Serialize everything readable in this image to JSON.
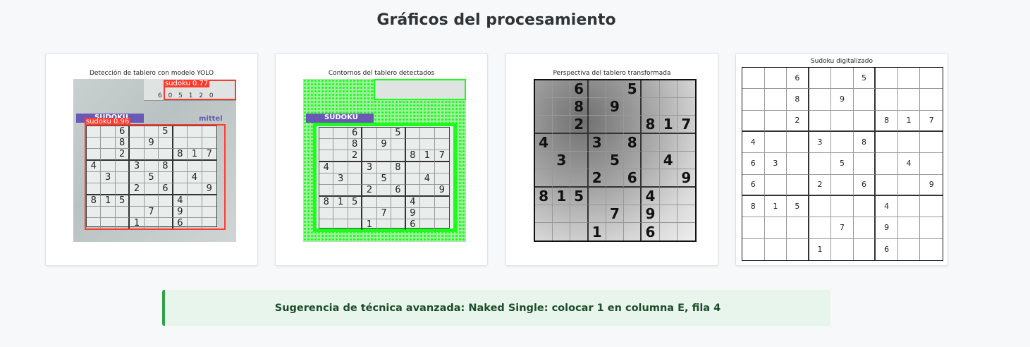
{
  "header": {
    "title": "Gráficos del procesamiento"
  },
  "panels": [
    {
      "title": "Detección de tablero con modelo YOLO"
    },
    {
      "title": "Contornos del tablero detectados"
    },
    {
      "title": "Perspectiva del tablero transformada"
    },
    {
      "title": "Sudoku digitalizado"
    }
  ],
  "detections": [
    {
      "label": "sudoku 0.77",
      "confidence": 0.77
    },
    {
      "label": "sudoku 0.96",
      "confidence": 0.96
    }
  ],
  "photo_text": {
    "brand_left": "SUDOKU",
    "brand_right": "mittel",
    "top_strip_digits": "6 0 5 1 2 0"
  },
  "board": [
    [
      "",
      "",
      "6",
      "",
      "",
      "5",
      "",
      "",
      ""
    ],
    [
      "",
      "",
      "8",
      "",
      "9",
      "",
      "",
      "",
      ""
    ],
    [
      "",
      "",
      "2",
      "",
      "",
      "",
      "8",
      "1",
      "7"
    ],
    [
      "4",
      "",
      "",
      "3",
      "",
      "8",
      "",
      "",
      ""
    ],
    [
      "6",
      "3",
      "",
      "",
      "5",
      "",
      "",
      "4",
      ""
    ],
    [
      "6",
      "",
      "",
      "2",
      "",
      "6",
      "",
      "",
      "9"
    ],
    [
      "8",
      "1",
      "5",
      "",
      "",
      "",
      "4",
      "",
      ""
    ],
    [
      "",
      "",
      "",
      "",
      "7",
      "",
      "9",
      "",
      ""
    ],
    [
      "",
      "",
      "",
      "1",
      "",
      "",
      "6",
      "",
      ""
    ]
  ],
  "photo_board": [
    [
      "",
      "",
      "6",
      "",
      "",
      "5",
      "",
      "",
      ""
    ],
    [
      "",
      "",
      "8",
      "",
      "9",
      "",
      "",
      "",
      ""
    ],
    [
      "",
      "",
      "2",
      "",
      "",
      "",
      "8",
      "1",
      "7"
    ],
    [
      "4",
      "",
      "",
      "3",
      "",
      "8",
      "",
      "",
      ""
    ],
    [
      "",
      "3",
      "",
      "",
      "5",
      "",
      "",
      "4",
      ""
    ],
    [
      "",
      "",
      "",
      "2",
      "",
      "6",
      "",
      "",
      "9"
    ],
    [
      "8",
      "1",
      "5",
      "",
      "",
      "",
      "4",
      "",
      ""
    ],
    [
      "",
      "",
      "",
      "",
      "7",
      "",
      "9",
      "",
      ""
    ],
    [
      "",
      "",
      "",
      "1",
      "",
      "",
      "6",
      "",
      ""
    ]
  ],
  "suggestion": {
    "text": "Sugerencia de técnica avanzada: Naked Single: colocar 1 en columna E, fila 4"
  },
  "colors": {
    "detection": "#ff3b2d",
    "contour": "#19ff19",
    "success": "#2fa24a"
  }
}
